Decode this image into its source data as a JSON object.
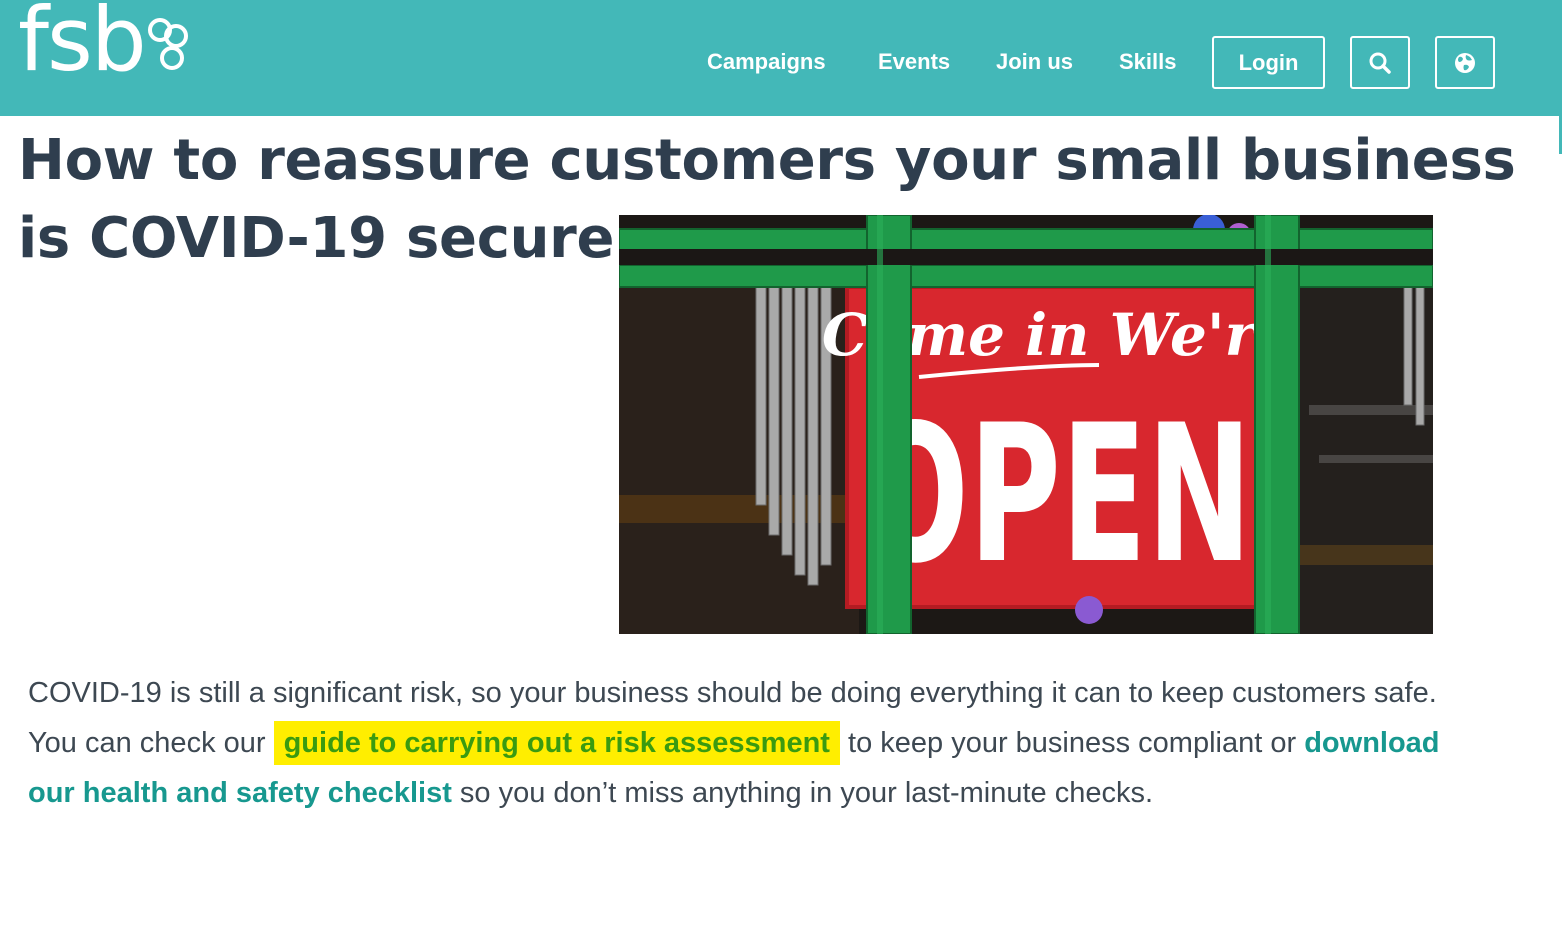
{
  "header": {
    "logo_text": "fsb",
    "nav": [
      "Campaigns",
      "Events",
      "Join us",
      "Skills"
    ],
    "login_label": "Login",
    "search_icon": "search-icon",
    "globe_icon": "globe-icon",
    "bg_color": "#43b8b8"
  },
  "article": {
    "title": "How to reassure customers your small business is COVID-19 secure",
    "image": {
      "sign_top": "Come in We're",
      "sign_main": "OPEN"
    },
    "paragraph": {
      "part1": "COVID-19 is still a significant risk, so your business should be doing everything it can to keep customers safe. You can check our ",
      "link1": "guide to carrying out a risk assessment",
      "part2": " to keep your business compliant or ",
      "link2": "download our health and safety checklist",
      "part3": " so you don’t miss anything in your last-minute checks."
    },
    "colors": {
      "title": "#2f3e4e",
      "link": "#17988f",
      "highlight_bg": "#ffee00",
      "highlight_text": "#3a9b10"
    }
  }
}
